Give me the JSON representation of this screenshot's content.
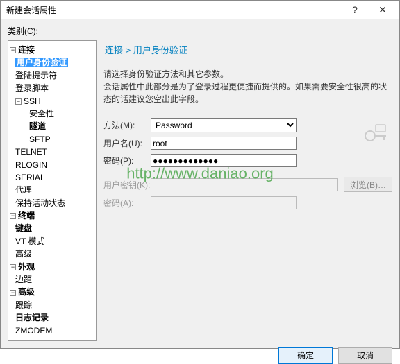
{
  "window": {
    "title": "新建会话属性",
    "help": "?",
    "close": "✕"
  },
  "category_label": "类别(C):",
  "tree": {
    "connection": "连接",
    "auth": "用户身份验证",
    "login_prompt": "登陆提示符",
    "login_script": "登录脚本",
    "ssh": "SSH",
    "security": "安全性",
    "tunnel": "隧道",
    "sftp": "SFTP",
    "telnet": "TELNET",
    "rlogin": "RLOGIN",
    "serial": "SERIAL",
    "proxy": "代理",
    "keepalive": "保持活动状态",
    "terminal": "终端",
    "keyboard": "键盘",
    "vt": "VT 模式",
    "advanced_t": "高级",
    "appearance": "外观",
    "margin": "边距",
    "advanced": "高级",
    "trace": "跟踪",
    "log": "日志记录",
    "zmodem": "ZMODEM"
  },
  "breadcrumb": "连接 > 用户身份验证",
  "description_line1": "请选择身份验证方法和其它参数。",
  "description_line2": "会话属性中此部分是为了登录过程更便捷而提供的。如果需要安全性很高的状态的话建议您空出此字段。",
  "form": {
    "method_label": "方法(M):",
    "method_value": "Password",
    "username_label": "用户名(U):",
    "username_value": "root",
    "password_label": "密码(P):",
    "password_value": "●●●●●●●●●●●●●",
    "pubkey_label": "用户密钥(K):",
    "pubkey_value": "",
    "browse_label": "浏览(B)…",
    "password2_label": "密码(A):",
    "password2_value": ""
  },
  "footer": {
    "ok": "确定",
    "cancel": "取消"
  },
  "watermark": "http://www.daniao.org"
}
